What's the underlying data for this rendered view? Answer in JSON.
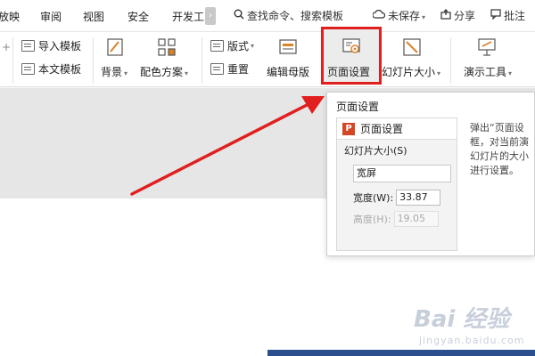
{
  "menu": {
    "items": [
      "放映",
      "审阅",
      "视图",
      "安全",
      "开发工"
    ],
    "search": "查找命令、搜索模板",
    "unsaved": "未保存",
    "share": "分享",
    "comment": "批注"
  },
  "ribbon": {
    "import_template": "导入模板",
    "this_template": "本文模板",
    "background": "背景",
    "color_scheme": "配色方案",
    "layout": "版式",
    "reset": "重置",
    "edit_master": "编辑母版",
    "page_setup": "页面设置",
    "slide_size": "幻灯片大小",
    "presenter_tools": "演示工具"
  },
  "tooltip": {
    "title": "页面设置",
    "dialog_title": "页面设置",
    "group_label": "幻灯片大小(S)",
    "size_value": "宽屏",
    "width_label": "宽度(W):",
    "width_value": "33.87",
    "height_label": "高度(H):",
    "height_value": "19.05",
    "description_lines": [
      "弹出“页面设",
      "框，对当前演",
      "幻灯片的大小",
      "进行设置。"
    ]
  },
  "watermark": {
    "main": "Bai 经验",
    "sub": "jingyan.baidu.com"
  },
  "colors": {
    "highlight": "#e01f1f",
    "arrow": "#e01f1f",
    "ppt_logo": "#d24726",
    "bottom_strip": "#2b4e8f"
  }
}
